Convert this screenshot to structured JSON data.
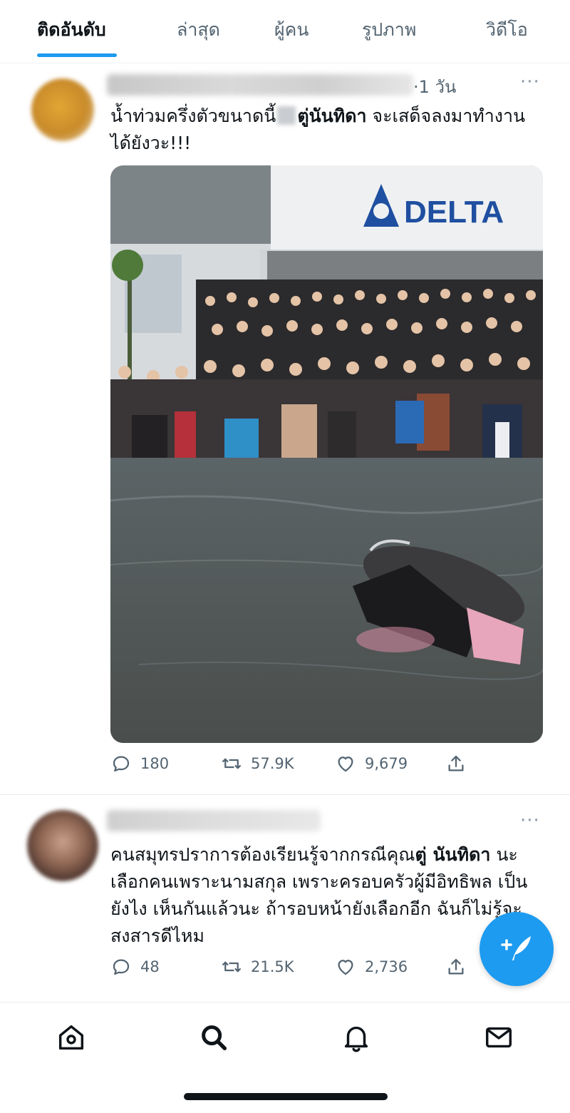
{
  "tabs": [
    {
      "label": "ติดอันดับ",
      "active": true
    },
    {
      "label": "ล่าสุด",
      "active": false
    },
    {
      "label": "ผู้คน",
      "active": false
    },
    {
      "label": "รูปภาพ",
      "active": false
    },
    {
      "label": "วิดีโอ",
      "active": false
    }
  ],
  "tweets": [
    {
      "time": "·1 วัน",
      "text_a": "น้ำท่วมครึ่งตัวขนาดนี้",
      "text_b": "ตู่นันทิดา",
      "text_c": " จะเสด็จลงมาทำงานได้ยังวะ!!!",
      "image_sign": "DELTA",
      "replies": "180",
      "retweets": "57.9K",
      "likes": "9,679"
    },
    {
      "text_a": "คนสมุทรปราการต้องเรียนรู้จากกรณีคุณ",
      "text_b": "ตู่ นันทิดา",
      "text_c": " นะ เลือกคนเพราะนามสกุล เพราะครอบครัวผู้มีอิทธิพล เป็นยังไง เห็นกันแล้วนะ ถ้ารอบหน้ายังเลือกอีก ฉันก็ไม่รู้จะสงสารดีไหม",
      "replies": "48",
      "retweets": "21.5K",
      "likes": "2,736"
    }
  ],
  "more_label": "···",
  "icons": {
    "reply": "reply-icon",
    "retweet": "retweet-icon",
    "like": "heart-icon",
    "share": "share-icon",
    "compose": "compose-tweet-icon",
    "nav": [
      "home-icon",
      "search-icon",
      "notifications-icon",
      "messages-icon"
    ]
  },
  "colors": {
    "accent": "#1d9bf0",
    "text": "#0f1419",
    "muted": "#536471"
  }
}
